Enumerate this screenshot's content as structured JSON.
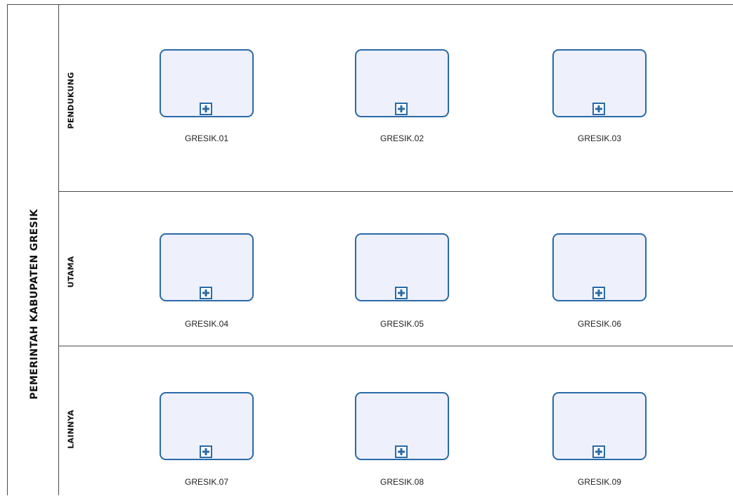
{
  "pool": {
    "title": "PEMERINTAH KABUPATEN GRESIK"
  },
  "lanes": [
    {
      "label": "PENDUKUNG",
      "tasks": [
        {
          "label": "GRESIK.01"
        },
        {
          "label": "GRESIK.02"
        },
        {
          "label": "GRESIK.03"
        }
      ]
    },
    {
      "label": "UTAMA",
      "tasks": [
        {
          "label": "GRESIK.04"
        },
        {
          "label": "GRESIK.05"
        },
        {
          "label": "GRESIK.06"
        }
      ]
    },
    {
      "label": "LAINNYA",
      "tasks": [
        {
          "label": "GRESIK.07"
        },
        {
          "label": "GRESIK.08"
        },
        {
          "label": "GRESIK.09"
        }
      ]
    }
  ],
  "colors": {
    "task_border": "#2a6aa8",
    "task_fill": "#eef0fb",
    "line": "#4a4a4a"
  },
  "icons": {
    "expand_marker": "plus-square-icon"
  }
}
